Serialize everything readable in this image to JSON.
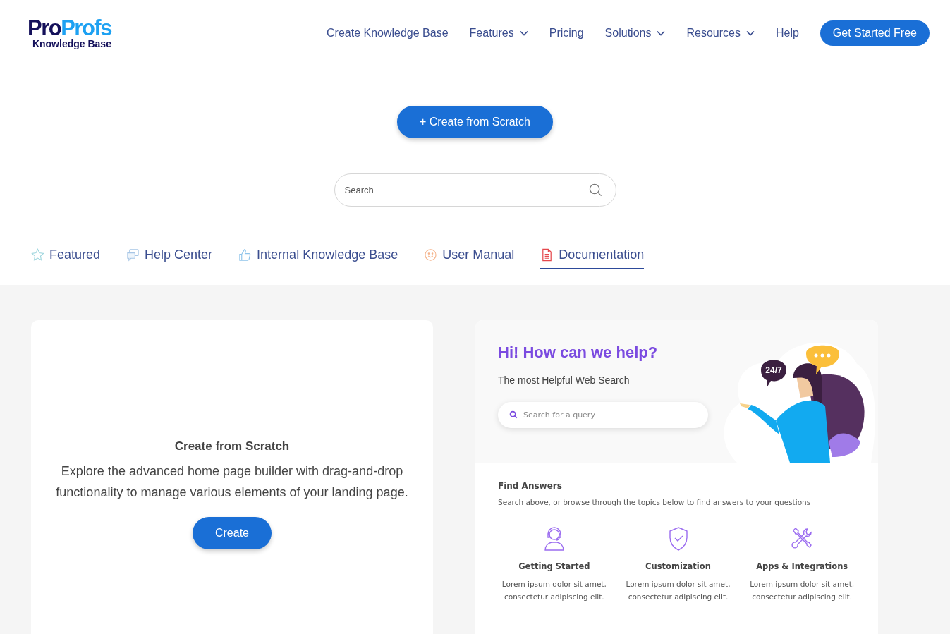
{
  "header": {
    "logo": {
      "primary": "Pro",
      "secondary": "Profs",
      "tagline": "Knowledge Base"
    },
    "nav": [
      {
        "label": "Create Knowledge Base",
        "dropdown": false
      },
      {
        "label": "Features",
        "dropdown": true
      },
      {
        "label": "Pricing",
        "dropdown": false
      },
      {
        "label": "Solutions",
        "dropdown": true
      },
      {
        "label": "Resources",
        "dropdown": true
      },
      {
        "label": "Help",
        "dropdown": false
      }
    ],
    "cta": "Get Started Free"
  },
  "hero": {
    "create_button": "+ Create from Scratch",
    "search": {
      "placeholder": "Search"
    }
  },
  "tabs": [
    {
      "label": "Featured",
      "kind": "star",
      "selected": false
    },
    {
      "label": "Help Center",
      "kind": "chat",
      "selected": false
    },
    {
      "label": "Internal Knowledge Base",
      "kind": "thumb",
      "selected": false
    },
    {
      "label": "User Manual",
      "kind": "smile",
      "selected": false
    },
    {
      "label": "Documentation",
      "kind": "document",
      "selected": true
    }
  ],
  "scratch_card": {
    "title": "Create from Scratch",
    "description": "Explore the advanced home page builder with drag-and-drop functionality to manage various elements of your landing page.",
    "button": "Create"
  },
  "preview": {
    "heading": "Hi! How can we help?",
    "subheading": "The most Helpful Web Search",
    "search": {
      "placeholder": "Search for a query"
    },
    "bubble": "24/7",
    "section_title": "Find Answers",
    "section_text": "Search above, or browse through the topics below to find answers to your questions",
    "topics": [
      {
        "kind": "headset",
        "title": "Getting Started",
        "text": "Lorem ipsum dolor sit amet, consectetur adipiscing elit."
      },
      {
        "kind": "shield",
        "title": "Customization",
        "text": "Lorem ipsum dolor sit amet, consectetur adipiscing elit."
      },
      {
        "kind": "tools",
        "title": "Apps & Integrations",
        "text": "Lorem ipsum dolor sit amet, consectetur adipiscing elit."
      }
    ]
  }
}
